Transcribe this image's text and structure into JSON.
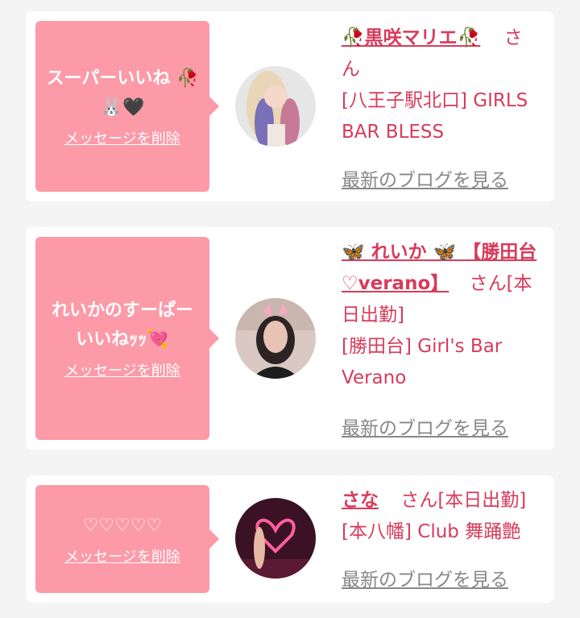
{
  "items": [
    {
      "bubble_line1": "スーパーいいね 🥀",
      "bubble_line2": "🐰🖤",
      "delete": "メッセージを削除",
      "name": "🥀黒咲マリエ🥀",
      "suffix": "さ",
      "suffix2": "ん",
      "shop_line1": "[八王子駅北口] GIRLS",
      "shop_line2": "BAR BLESS",
      "blog": "最新のブログを見る"
    },
    {
      "bubble_line1": "れいかのすーぱー",
      "bubble_line2": "いいねｯｯ💘",
      "delete": "メッセージを削除",
      "name_line1": "🦋 れいか 🦋 【勝田台",
      "name_line2": "♡verano】",
      "suffix": "さん[本",
      "suffix2": "日出勤]",
      "shop_line1": "[勝田台] Girl's Bar",
      "shop_line2": "Verano",
      "blog": "最新のブログを見る"
    },
    {
      "bubble_line1": "♡♡♡♡♡",
      "delete": "メッセージを削除",
      "name": "さな",
      "suffix": "さん[本日出勤]",
      "shop_line1": "[本八幡] Club 舞踊艶",
      "blog": "最新のブログを見る"
    }
  ],
  "colors": {
    "bubble": "#fc9aa8",
    "accent": "#d83b5b",
    "link_gray": "#888888"
  }
}
